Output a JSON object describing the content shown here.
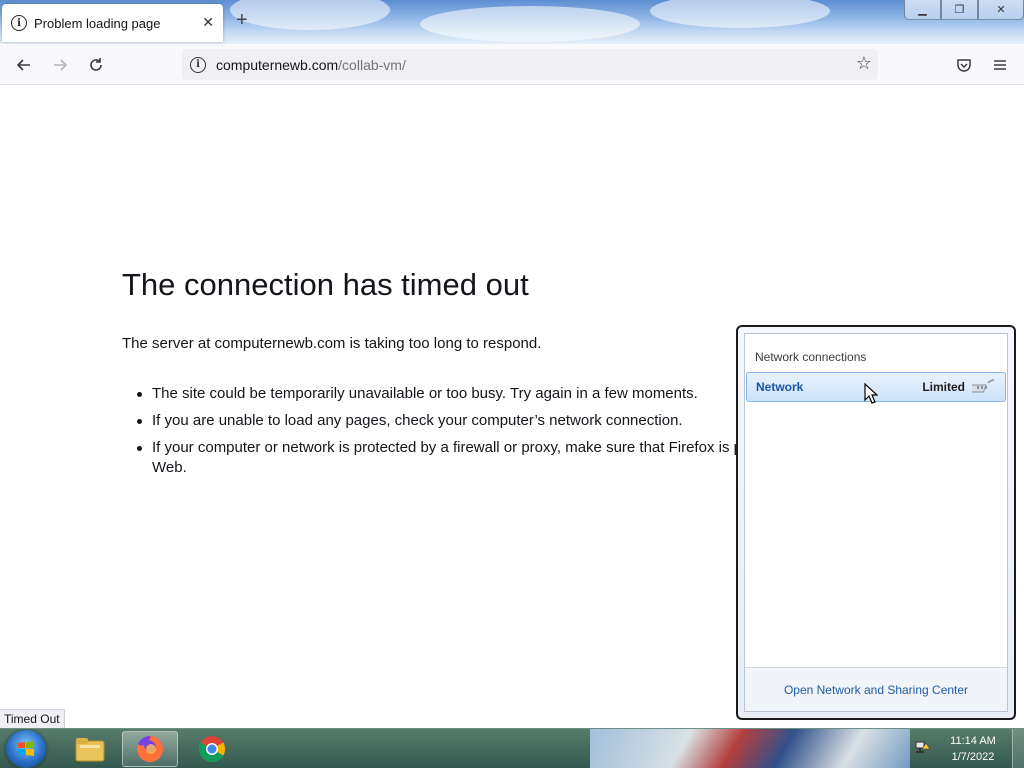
{
  "browser": {
    "tab": {
      "title": "Problem loading page",
      "icon": "info-icon"
    },
    "window_controls": {
      "minimize": "minimize-icon",
      "restore": "restore-icon",
      "close": "close-icon"
    },
    "url": {
      "host": "computernewb.com",
      "path": "/collab-vm/"
    }
  },
  "error_page": {
    "title": "The connection has timed out",
    "description": "The server at computernewb.com is taking too long to respond.",
    "bullets": [
      "The site could be temporarily unavailable or too busy. Try again in a few moments.",
      "If you are unable to load any pages, check your computer’s network connection.",
      "If your computer or network is protected by a firewall or proxy, make sure that Firefox is p",
      "Web."
    ]
  },
  "status_bar": {
    "text": "Timed Out"
  },
  "network_popup": {
    "heading": "Network connections",
    "network": {
      "name": "Network",
      "status": "Limited"
    },
    "link": "Open Network and Sharing Center"
  },
  "taskbar": {
    "items": [
      "Windows Explorer",
      "Firefox",
      "Google Chrome"
    ],
    "clock": {
      "time": "11:14 AM",
      "date": "1/7/2022"
    }
  },
  "colors": {
    "link": "#1f5aa6",
    "network_name": "#1a56a6",
    "selected_bg": "#cde3fa"
  }
}
